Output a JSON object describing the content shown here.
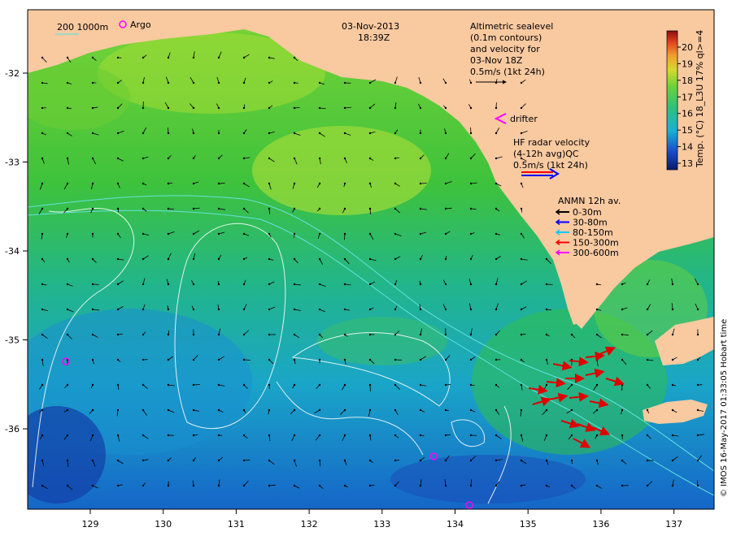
{
  "title": {
    "date": "03-Nov-2013",
    "time": "18:39Z"
  },
  "scale_legend": {
    "isobath_label": "200  1000m",
    "argo_label": "Argo"
  },
  "altimetry_legend": {
    "lines": [
      "Altimetric sealevel",
      "(0.1m contours)",
      "and velocity for",
      "03-Nov 18Z",
      "0.5m/s (1kt 24h)"
    ]
  },
  "drifter_legend": {
    "label": "drifter"
  },
  "hf_radar_legend": {
    "lines": [
      "HF radar velocity",
      "(4-12h avg)QC",
      "0.5m/s (1kt 24h)"
    ]
  },
  "anmn_legend": {
    "title": "ANMN 12h av.",
    "items": [
      {
        "label": "0-30m",
        "color": "#000000"
      },
      {
        "label": "30-80m",
        "color": "#0000ff"
      },
      {
        "label": "80-150m",
        "color": "#00ccff"
      },
      {
        "label": "150-300m",
        "color": "#ff0000"
      },
      {
        "label": "300-600m",
        "color": "#ff00ff"
      }
    ]
  },
  "colorbar": {
    "label": "Temp. (°C) 18_L3U 17% ql>=4",
    "ticks": [
      "13",
      "14",
      "15",
      "16",
      "17",
      "18",
      "19",
      "20"
    ]
  },
  "axes": {
    "x_ticks": [
      "129",
      "130",
      "131",
      "132",
      "133",
      "134",
      "135",
      "136",
      "137"
    ],
    "y_ticks": [
      "-32",
      "-33",
      "-34",
      "-35",
      "-36"
    ]
  },
  "credit": "© IMOS 16-May-2017 01:33:05 Hobart time",
  "colors": {
    "land": "#f9c9a0",
    "argo": "#ff00ff",
    "hf_radar": "#ff0000",
    "isobath": "#66e0e0",
    "contour": "#ffffff"
  }
}
